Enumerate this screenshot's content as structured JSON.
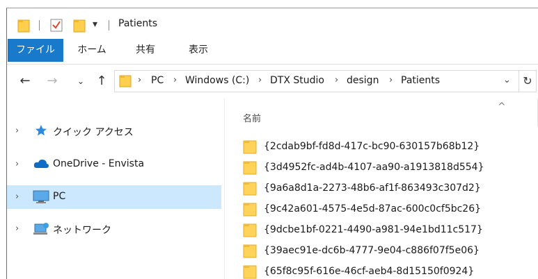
{
  "window": {
    "title": "Patients",
    "quick_access_dropdown": "▾"
  },
  "ribbon": {
    "tabs": [
      {
        "label": "ファイル",
        "active": true
      },
      {
        "label": "ホーム"
      },
      {
        "label": "共有"
      },
      {
        "label": "表示"
      }
    ],
    "accent": "#1979ca"
  },
  "address_bar": {
    "crumbs": [
      "PC",
      "Windows (C:)",
      "DTX Studio",
      "design",
      "Patients"
    ]
  },
  "nav_pane": {
    "items": [
      {
        "label": "クイック アクセス",
        "icon": "star-icon"
      },
      {
        "label": "OneDrive - Envista",
        "icon": "cloud-icon"
      },
      {
        "label": "PC",
        "icon": "monitor-icon",
        "selected": true
      },
      {
        "label": "ネットワーク",
        "icon": "network-icon"
      }
    ]
  },
  "file_list": {
    "column_name": "名前",
    "items": [
      "{2cdab9bf-fd8d-417c-bc90-630157b68b12}",
      "{3d4952fc-ad4b-4107-aa90-a1913818d554}",
      "{9a6a8d1a-2273-48b6-af1f-863493c307d2}",
      "{9c42a601-4575-4e5d-87ac-600c0cf5bc26}",
      "{9dcbe1bf-0221-4490-a981-94e1bd11c517}",
      "{39aec91e-dc6b-4777-9e04-c886f07f5e06}",
      "{65f8c95f-616e-46cf-aeb4-8d15150f0924}"
    ]
  }
}
